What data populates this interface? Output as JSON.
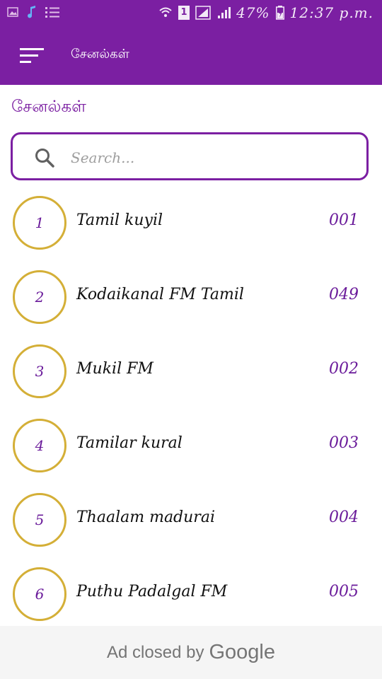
{
  "status_bar": {
    "battery": "47%",
    "time": "12:37 p.m.",
    "sim_badge": "1"
  },
  "app_bar": {
    "title": "சேனல்கள்"
  },
  "section": {
    "title": "சேனல்கள்"
  },
  "search": {
    "placeholder": "Search..."
  },
  "channels": [
    {
      "index": "1",
      "name": "Tamil kuyil",
      "code": "001"
    },
    {
      "index": "2",
      "name": "Kodaikanal FM Tamil",
      "code": "049"
    },
    {
      "index": "3",
      "name": "Mukil FM",
      "code": "002"
    },
    {
      "index": "4",
      "name": "Tamilar kural",
      "code": "003"
    },
    {
      "index": "5",
      "name": "Thaalam madurai",
      "code": "004"
    },
    {
      "index": "6",
      "name": "Puthu Padalgal FM",
      "code": "005"
    }
  ],
  "ad": {
    "text": "Ad closed by",
    "brand": "Google"
  },
  "colors": {
    "primary": "#7b1fa2",
    "circle_border": "#d4af37",
    "code_text": "#6a1b9a"
  }
}
